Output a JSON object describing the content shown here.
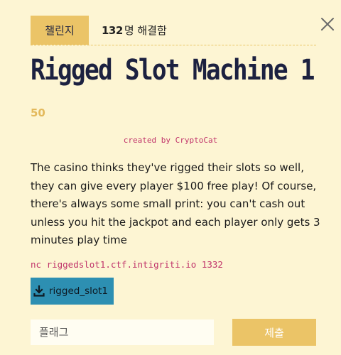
{
  "header": {
    "category": "챌린지",
    "solve_count": "132",
    "solve_suffix": "명 해결함",
    "close_icon": "close-icon"
  },
  "challenge": {
    "title": "Rigged Slot Machine 1",
    "points": "50",
    "author": "created by CryptoCat",
    "description": "The casino thinks they've rigged their slots so well, they can give every player $100 free play! Of course, there's always some small print: you can't cash out unless you hit the jackpot and each player only gets 3 minutes play time",
    "connection": "nc riggedslot1.ctf.intigriti.io 1332"
  },
  "download": {
    "icon": "download-icon",
    "label": "rigged_slot1"
  },
  "form": {
    "placeholder": "플래그",
    "submit_label": "제출"
  },
  "colors": {
    "background": "#fdf5d3",
    "accent": "#ebc467",
    "title": "#1c2140",
    "link": "#c0336a",
    "download": "#2d8fb2"
  }
}
